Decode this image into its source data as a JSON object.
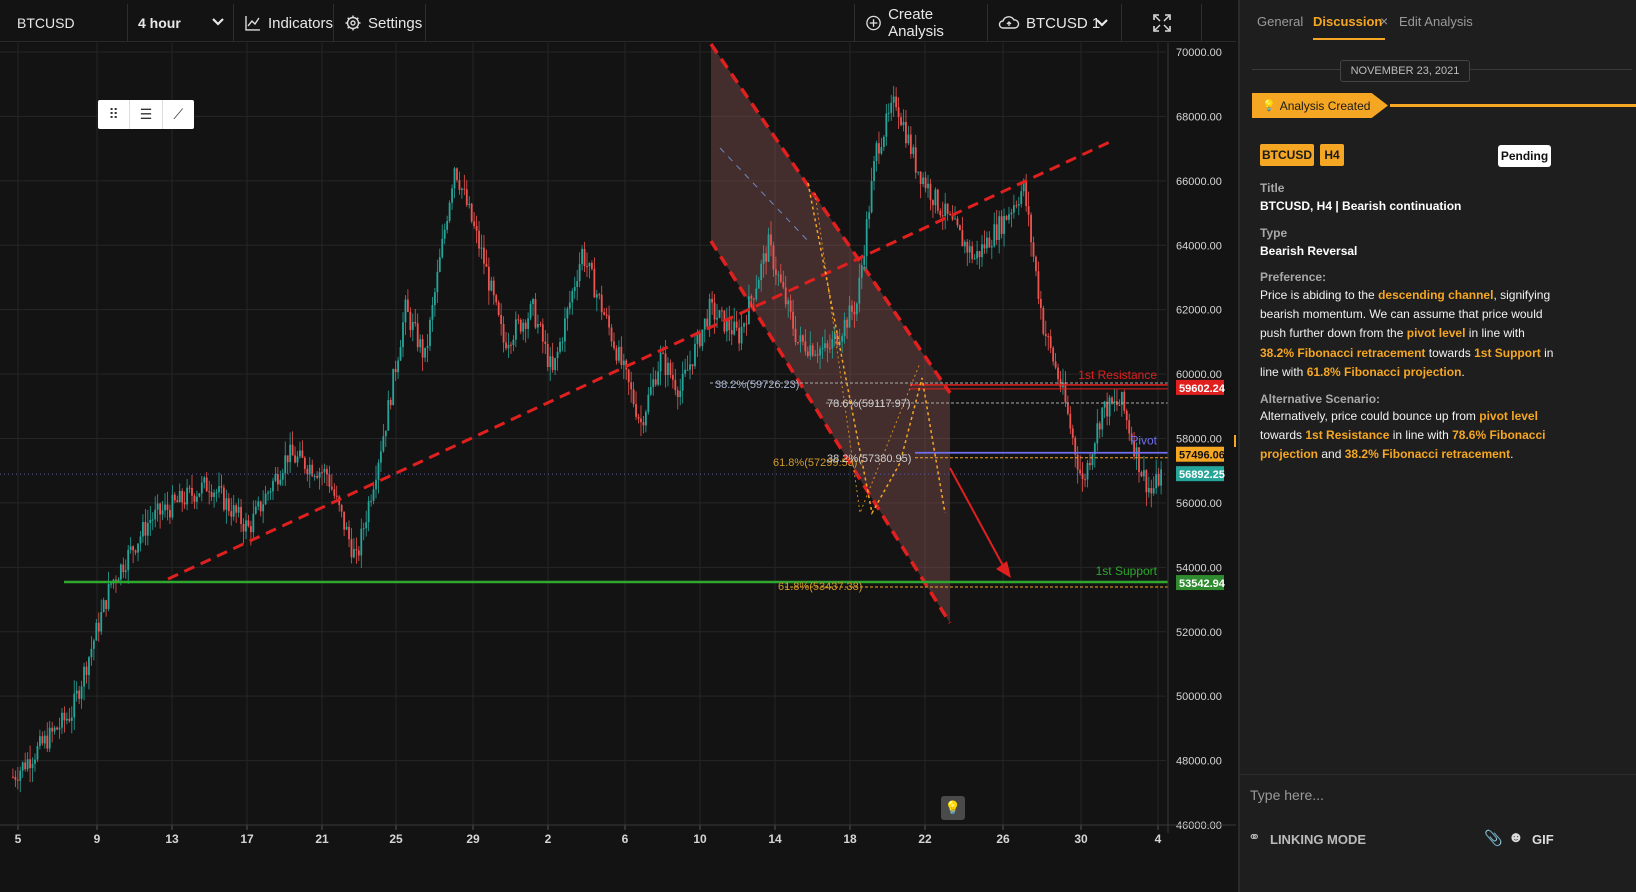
{
  "toolbar": {
    "symbol": "BTCUSD",
    "interval": "4 hour",
    "indicators_label": "Indicators",
    "settings_label": "Settings",
    "create_analysis_label": "Create Analysis",
    "layout_label": "BTCUSD 1"
  },
  "icons": {
    "interval_dropdown": "chevron-down-icon",
    "indicators": "line-chart-icon",
    "settings": "gear-icon",
    "create_analysis": "plus-circle-icon",
    "cloud": "cloud-upload-icon",
    "layout_dropdown": "chevron-down-icon",
    "fullscreen": "expand-icon",
    "drag": "drag-handle-icon",
    "lines": "lines-icon",
    "sparkle": "sparkle-icon",
    "lightbulb": "lightbulb-icon",
    "link": "link-icon",
    "attach": "paperclip-icon",
    "emoji": "emoji-icon"
  },
  "chart_data": {
    "type": "candlestick",
    "symbol": "BTCUSD",
    "timeframe": "H4",
    "ylim": [
      46000,
      70000
    ],
    "y_ticks": [
      "70000.00",
      "68000.00",
      "66000.00",
      "64000.00",
      "62000.00",
      "60000.00",
      "58000.00",
      "56000.00",
      "54000.00",
      "52000.00",
      "50000.00",
      "48000.00",
      "46000.00"
    ],
    "x_ticks": [
      "5",
      "9",
      "13",
      "17",
      "21",
      "25",
      "29",
      "2",
      "6",
      "10",
      "14",
      "18",
      "22",
      "26",
      "30",
      "4"
    ],
    "price_path": [
      [
        0,
        47500
      ],
      [
        6,
        49500
      ],
      [
        10,
        53500
      ],
      [
        14,
        55500
      ],
      [
        20,
        56600
      ],
      [
        24,
        55200
      ],
      [
        28,
        57500
      ],
      [
        32,
        56900
      ],
      [
        35,
        54200
      ],
      [
        38,
        58500
      ],
      [
        40,
        62000
      ],
      [
        42,
        60500
      ],
      [
        45,
        66500
      ],
      [
        48,
        63500
      ],
      [
        50,
        61000
      ],
      [
        53,
        62000
      ],
      [
        55,
        60000
      ],
      [
        58,
        63800
      ],
      [
        61,
        61200
      ],
      [
        64,
        58500
      ],
      [
        66,
        60500
      ],
      [
        68,
        59500
      ],
      [
        71,
        62000
      ],
      [
        74,
        61200
      ],
      [
        77,
        64000
      ],
      [
        80,
        61000
      ],
      [
        83,
        60700
      ],
      [
        86,
        62200
      ],
      [
        88,
        67000
      ],
      [
        90,
        68500
      ],
      [
        92,
        66500
      ],
      [
        94,
        65400
      ],
      [
        96,
        64500
      ],
      [
        98,
        63600
      ],
      [
        101,
        64800
      ],
      [
        103,
        65800
      ],
      [
        105,
        61500
      ],
      [
        107,
        59400
      ],
      [
        109,
        56600
      ],
      [
        111,
        58900
      ],
      [
        113,
        59100
      ],
      [
        115,
        57000
      ],
      [
        116,
        56300
      ],
      [
        117,
        56900
      ]
    ],
    "current_price_label": "56892.25",
    "levels": [
      {
        "name": "1st Resistance",
        "price": 59602.24,
        "label": "59602.24",
        "color": "#e0201f"
      },
      {
        "name": "Pivot",
        "price": 57496.06,
        "label": "57496.06",
        "color": "#f5a623"
      },
      {
        "name": "1st Support",
        "price": 53542.94,
        "label": "53542.94",
        "color": "#2e8b2e"
      }
    ],
    "fib_labels": [
      "38.2%(59726.23)",
      "78.6%(59117.97)",
      "61.8%(57299.53)",
      "38.2%(57380.95)",
      "61.8%(53437.38)"
    ],
    "annotations": [
      "1st Resistance",
      "Pivot",
      "1st Support"
    ]
  },
  "panel": {
    "tabs": [
      "General",
      "Discussion",
      "Edit Analysis"
    ],
    "active_tab": "Discussion",
    "tab_close": "×",
    "date": "NOVEMBER 23, 2021",
    "event": "Analysis Created",
    "tags": [
      "BTCUSD",
      "H4"
    ],
    "status": "Pending",
    "title_label": "Title",
    "title_value": "BTCUSD, H4 | Bearish continuation",
    "type_label": "Type",
    "type_value": "Bearish Reversal",
    "preference_label": "Preference:",
    "preference_parts": [
      {
        "t": "Price is abiding to the ",
        "h": false
      },
      {
        "t": "descending channel",
        "h": true
      },
      {
        "t": ", signifying bearish momentum. We can assume that price would push further down from the ",
        "h": false
      },
      {
        "t": "pivot level",
        "h": true
      },
      {
        "t": " in line with ",
        "h": false
      },
      {
        "t": "38.2% Fibonacci retracement",
        "h": true
      },
      {
        "t": " towards ",
        "h": false
      },
      {
        "t": "1st Support",
        "h": true
      },
      {
        "t": " in line with ",
        "h": false
      },
      {
        "t": "61.8% Fibonacci projection",
        "h": true
      },
      {
        "t": ".",
        "h": false
      }
    ],
    "alternative_label": "Alternative Scenario:",
    "alternative_parts": [
      {
        "t": "Alternatively, price could bounce up from ",
        "h": false
      },
      {
        "t": "pivot level",
        "h": true
      },
      {
        "t": " towards ",
        "h": false
      },
      {
        "t": "1st Resistance",
        "h": true
      },
      {
        "t": " in line with ",
        "h": false
      },
      {
        "t": "78.6% Fibonacci projection",
        "h": true
      },
      {
        "t": " and ",
        "h": false
      },
      {
        "t": "38.2% Fibonacci retracement",
        "h": true
      },
      {
        "t": ".",
        "h": false
      }
    ],
    "input_placeholder": "Type here...",
    "linking_mode": "LINKING MODE",
    "gif_label": "GIF"
  },
  "colors": {
    "accent": "#f5a623",
    "up_candle": "#26a69a",
    "down_candle": "#ef5350",
    "resistance": "#e0201f",
    "support": "#2e8b2e",
    "pivot_line": "#6f6ff0",
    "current_price": "#26a69a"
  }
}
